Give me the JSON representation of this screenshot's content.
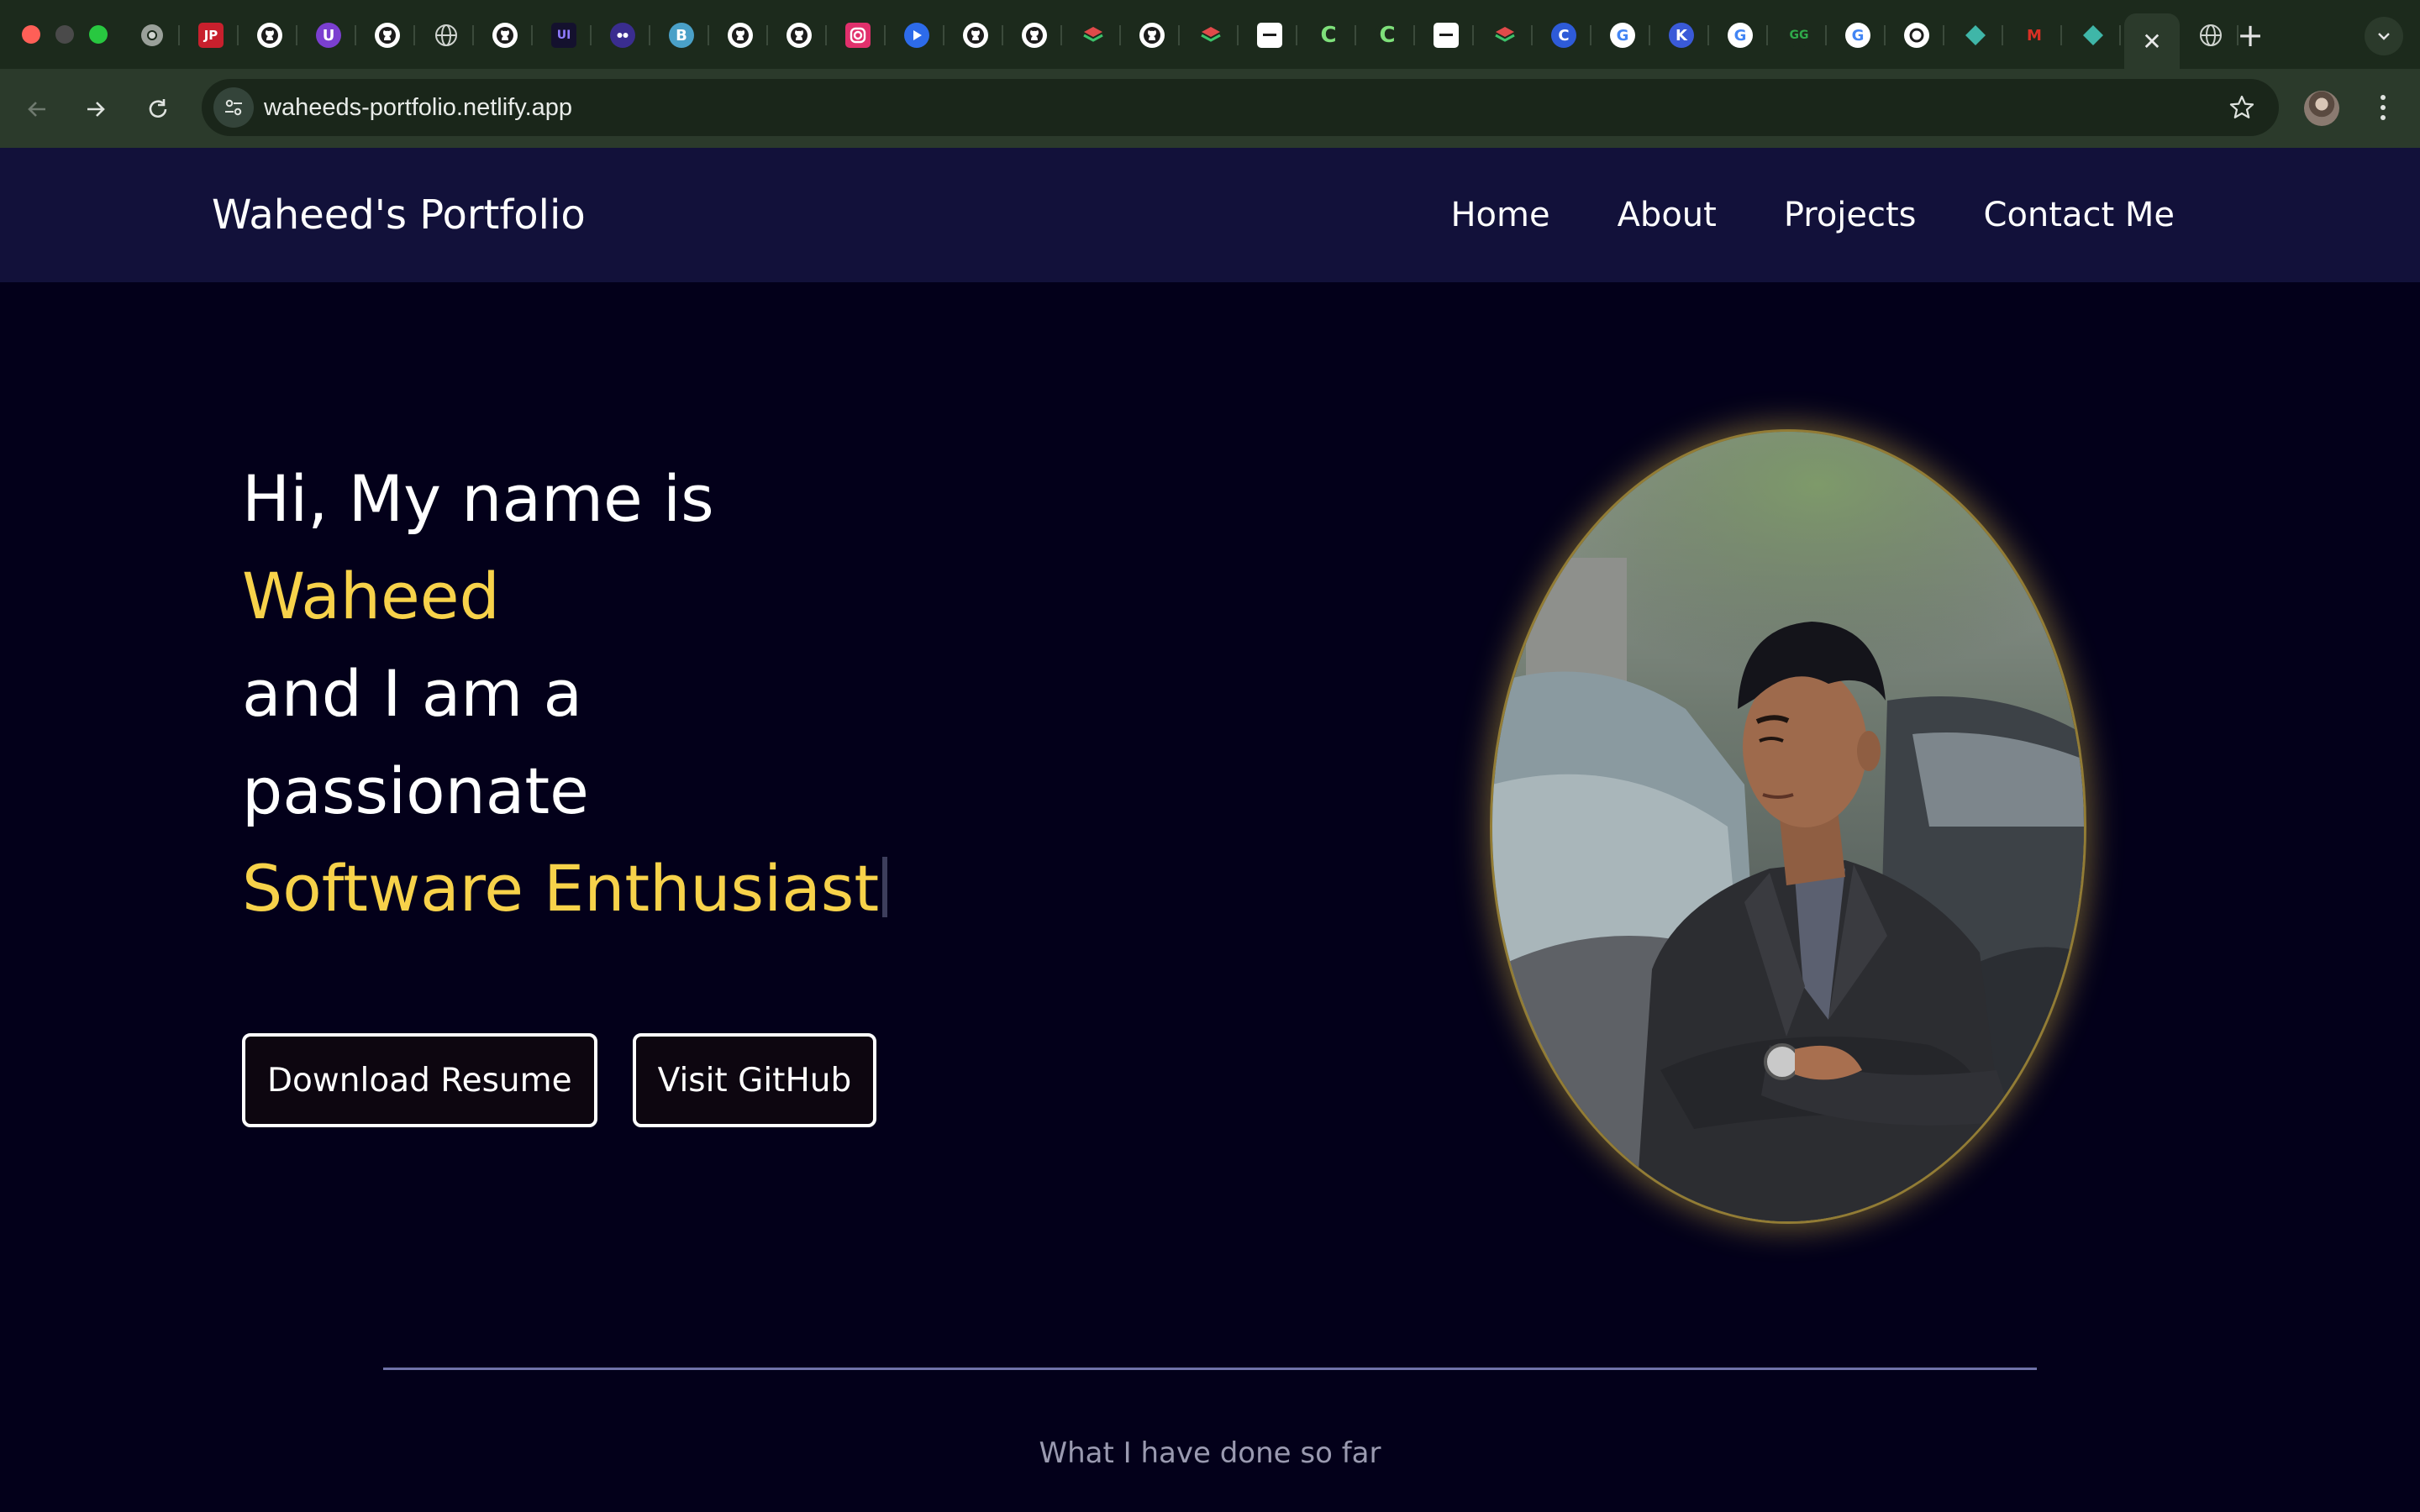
{
  "browser": {
    "url": "waheeds-portfolio.netlify.app",
    "tabs": [
      {
        "icon": "chrome-icon",
        "glyph": "",
        "bg": "#1c2a1c",
        "active": false
      },
      {
        "icon": "jp-icon",
        "glyph": "JP",
        "bg": "#c8202d",
        "active": false
      },
      {
        "icon": "github-icon",
        "glyph": "",
        "bg": "#ffffff",
        "active": false
      },
      {
        "icon": "u-icon",
        "glyph": "U",
        "bg": "#7b3fd0",
        "active": false
      },
      {
        "icon": "github-icon",
        "glyph": "",
        "bg": "#ffffff",
        "active": false
      },
      {
        "icon": "globe-icon",
        "glyph": "",
        "bg": "#6b6b6b",
        "active": false
      },
      {
        "icon": "github-icon",
        "glyph": "",
        "bg": "#ffffff",
        "active": false
      },
      {
        "icon": "ui-icon",
        "glyph": "UI",
        "bg": "#14112e",
        "active": false
      },
      {
        "icon": "bot-icon",
        "glyph": "",
        "bg": "#3a2d8f",
        "active": false
      },
      {
        "icon": "bootstrap-icon",
        "glyph": "B",
        "bg": "#4aa0c8",
        "active": false
      },
      {
        "icon": "github-icon",
        "glyph": "",
        "bg": "#ffffff",
        "active": false
      },
      {
        "icon": "github-icon",
        "glyph": "",
        "bg": "#ffffff",
        "active": false
      },
      {
        "icon": "instagram-icon",
        "glyph": "",
        "bg": "#e1306c",
        "active": false
      },
      {
        "icon": "play-icon",
        "glyph": "",
        "bg": "#2d6bea",
        "active": false
      },
      {
        "icon": "github-icon",
        "glyph": "",
        "bg": "#ffffff",
        "active": false
      },
      {
        "icon": "github-icon",
        "glyph": "",
        "bg": "#ffffff",
        "active": false
      },
      {
        "icon": "layers-icon",
        "glyph": "",
        "bg": "#2d8a4a",
        "active": false
      },
      {
        "icon": "github-icon",
        "glyph": "",
        "bg": "#ffffff",
        "active": false
      },
      {
        "icon": "layers-icon",
        "glyph": "",
        "bg": "#2d8a4a",
        "active": false
      },
      {
        "icon": "doc-icon",
        "glyph": "",
        "bg": "#ffffff",
        "active": false
      },
      {
        "icon": "c-icon",
        "glyph": "C",
        "bg": "#1c2a1c",
        "active": false
      },
      {
        "icon": "c-icon",
        "glyph": "C",
        "bg": "#1c2a1c",
        "active": false
      },
      {
        "icon": "doc-icon",
        "glyph": "",
        "bg": "#ffffff",
        "active": false
      },
      {
        "icon": "layers-icon",
        "glyph": "",
        "bg": "#2d8a4a",
        "active": false
      },
      {
        "icon": "c-icon",
        "glyph": "C",
        "bg": "#2e5bd8",
        "active": false
      },
      {
        "icon": "google-icon",
        "glyph": "G",
        "bg": "#ffffff",
        "active": false
      },
      {
        "icon": "k-icon",
        "glyph": "K",
        "bg": "#3a5ad8",
        "active": false
      },
      {
        "icon": "google-icon",
        "glyph": "G",
        "bg": "#ffffff",
        "active": false
      },
      {
        "icon": "gfg-icon",
        "glyph": "GG",
        "bg": "#1c2a1c",
        "active": false
      },
      {
        "icon": "google-icon",
        "glyph": "G",
        "bg": "#ffffff",
        "active": false
      },
      {
        "icon": "openai-icon",
        "glyph": "",
        "bg": "#ffffff",
        "active": false
      },
      {
        "icon": "diamond-icon",
        "glyph": "",
        "bg": "#1c2a1c",
        "active": false
      },
      {
        "icon": "gmail-icon",
        "glyph": "M",
        "bg": "#ffffff",
        "active": false
      },
      {
        "icon": "diamond-icon",
        "glyph": "",
        "bg": "#1c2a1c",
        "active": false
      },
      {
        "icon": "close-icon",
        "glyph": "",
        "bg": "",
        "active": true
      },
      {
        "icon": "globe-icon",
        "glyph": "",
        "bg": "#6b6b6b",
        "active": false
      }
    ]
  },
  "site": {
    "brand": "Waheed's Portfolio",
    "nav": [
      "Home",
      "About",
      "Projects",
      "Contact Me"
    ],
    "hero": {
      "line1": "Hi, My name is",
      "name": "Waheed",
      "line3": "and I am a",
      "line4": "passionate",
      "role": "Software Enthusiast"
    },
    "buttons": {
      "resume": "Download Resume",
      "github": "Visit GitHub"
    },
    "section_subtitle": "What I have done so far",
    "colors": {
      "background": "#03001a",
      "navbar": "#12113a",
      "accent": "#f7d24a",
      "divider": "#6f72a8"
    }
  }
}
